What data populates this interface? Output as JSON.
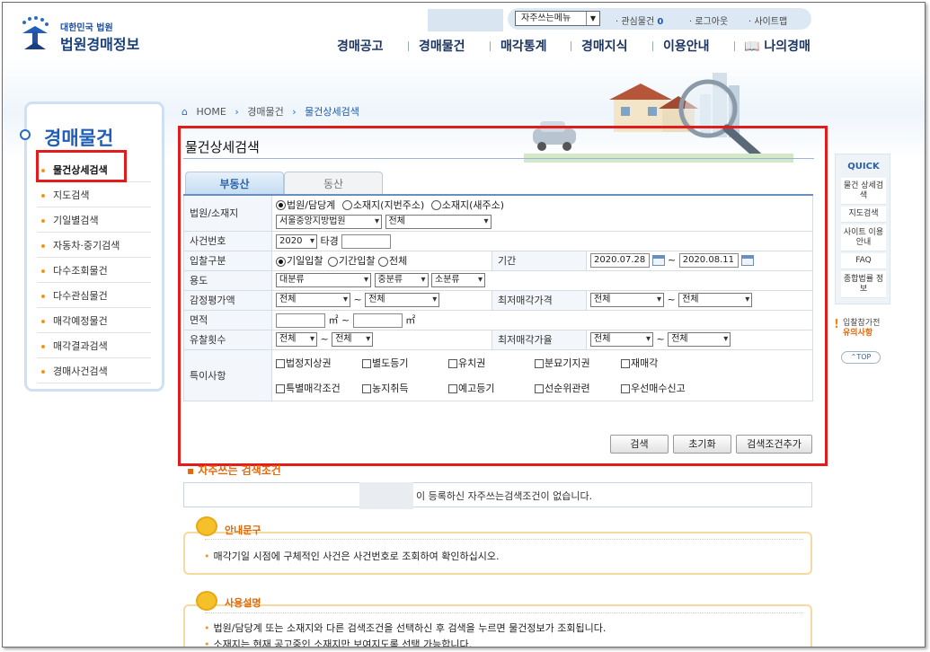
{
  "header": {
    "logo_small": "대한민국 법원",
    "logo_big": "법원경매정보",
    "fav_menu": "자주쓰는메뉴",
    "util": {
      "interest": "관심물건",
      "interest_count": "0",
      "login": "로그아웃",
      "sitemap": "사이트맵"
    },
    "nav": [
      "경매공고",
      "경매물건",
      "매각통계",
      "경매지식",
      "이용안내",
      "나의경매"
    ]
  },
  "breadcrumb": {
    "home": "HOME",
    "level1": "경매물건",
    "level2": "물건상세검색"
  },
  "sidebar": {
    "title": "경매물건",
    "items": [
      {
        "label": "물건상세검색"
      },
      {
        "label": "지도검색"
      },
      {
        "label": "기일별검색"
      },
      {
        "label": "자동차·중기검색"
      },
      {
        "label": "다수조회물건"
      },
      {
        "label": "다수관심물건"
      },
      {
        "label": "매각예정물건"
      },
      {
        "label": "매각결과검색"
      },
      {
        "label": "경매사건검색"
      }
    ]
  },
  "page": {
    "title": "물건상세검색",
    "tabs": [
      "부동산",
      "동산"
    ]
  },
  "form": {
    "court_label": "법원/소재지",
    "court_radios": [
      "법원/담당계",
      "소재지(지번주소)",
      "소재지(새주소)"
    ],
    "court_select": "서울중앙지방법원",
    "court_dept": "전체",
    "case_label": "사건번호",
    "case_year": "2020",
    "case_type": "타경",
    "bid_label": "입찰구분",
    "bid_radios": [
      "기일입찰",
      "기간입찰",
      "전체"
    ],
    "period_label": "기간",
    "period_from": "2020.07.28",
    "period_to": "2020.08.11",
    "use_label": "용도",
    "use_large": "대분류",
    "use_mid": "중분류",
    "use_small": "소분류",
    "appraisal_label": "감정평가액",
    "all": "전체",
    "tilde": "~",
    "min_price_label": "최저매각가격",
    "area_label": "면적",
    "area_unit": "㎡",
    "fail_label": "유찰횟수",
    "min_rate_label": "최저매각가율",
    "special_label": "특이사항",
    "special_row1": [
      "법정지상권",
      "별도등기",
      "유치권",
      "분묘기지권",
      "재매각"
    ],
    "special_row2": [
      "특별매각조건",
      "농지취득",
      "예고등기",
      "선순위관련",
      "우선매수신고"
    ]
  },
  "buttons": {
    "search": "검색",
    "reset": "초기화",
    "add": "검색조건추가"
  },
  "favorites": {
    "title": "자주쓰는 검색조건",
    "message": "이 등록하신 자주쓰는검색조건이 없습니다."
  },
  "guide": {
    "title": "안내문구",
    "text": "매각기일 시점에 구체적인 사건은 사건번호로 조회하여 확인하십시오."
  },
  "usage": {
    "title": "사용설명",
    "lines": [
      "법원/담당계 또는 소재지와 다른 검색조건을 선택하신 후 검색을 누르면 물건정보가 조회됩니다.",
      "소재지는 현재 공고중인 소재지만 보여지도록 선택 가능합니다."
    ]
  },
  "quick": {
    "title": "QUICK",
    "items": [
      "물건 상세검색",
      "지도검색",
      "사이트 이용안내",
      "FAQ",
      "종합법률 정보"
    ],
    "notice1": "입찰참가전",
    "notice2": "유의사항",
    "top": "TOP"
  }
}
